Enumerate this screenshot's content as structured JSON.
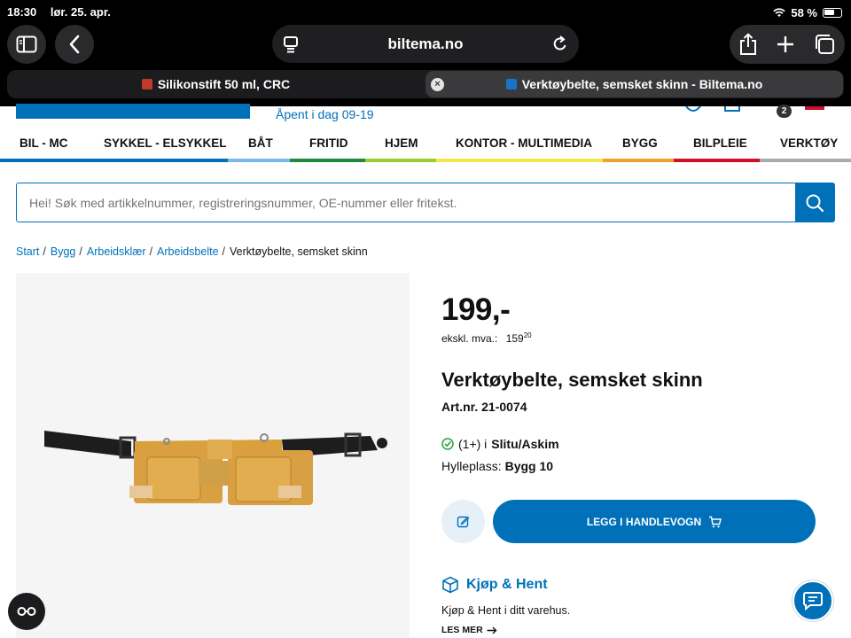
{
  "status_bar": {
    "time": "18:30",
    "date": "lør. 25. apr.",
    "battery": "58 %"
  },
  "browser": {
    "url": "biltema.no",
    "tabs": [
      {
        "label": "Silikonstift 50 ml, CRC",
        "active": false
      },
      {
        "label": "Verktøybelte, semsket skinn - Biltema.no",
        "active": true
      }
    ],
    "close_tab_glyph": "×"
  },
  "site": {
    "opening_hours": "Åpent i dag 09-19",
    "cart_count": "2",
    "nav": [
      "BIL - MC",
      "SYKKEL - ELSYKKEL",
      "BÅT",
      "FRITID",
      "HJEM",
      "KONTOR - MULTIMEDIA",
      "BYGG",
      "BILPLEIE",
      "VERKTØY"
    ],
    "nav_colors": [
      "#0071b9",
      "#0071b9",
      "#7ab8e8",
      "#1f8a3c",
      "#9acd32",
      "#f2e64a",
      "#f0a030",
      "#d0102b",
      "#aaaaaa"
    ],
    "search_placeholder": "Hei! Søk med artikkelnummer, registreringsnummer, OE-nummer eller fritekst.",
    "breadcrumb": [
      "Start",
      "Bygg",
      "Arbeidsklær",
      "Arbeidsbelte"
    ],
    "breadcrumb_current": "Verktøybelte, semsket skinn",
    "breadcrumb_sep": "/"
  },
  "product": {
    "price": "199,-",
    "ex_vat_label": "ekskl. mva.:",
    "ex_vat_whole": "159",
    "ex_vat_cents": "20",
    "title": "Verktøybelte, semsket skinn",
    "art_nr": "Art.nr. 21-0074",
    "stock_count": "(1+) i",
    "stock_store": "Slitu/Askim",
    "shelf_label": "Hylleplass:",
    "shelf_value": "Bygg 10",
    "add_to_cart": "LEGG I HANDLEVOGN"
  },
  "click_collect": {
    "title": "Kjøp & Hent",
    "text": "Kjøp & Hent i ditt varehus.",
    "more": "LES MER"
  },
  "colors": {
    "brand_blue": "#0071b9",
    "light_blue": "#e6f0f9",
    "stock_green": "#2e9e3f"
  }
}
